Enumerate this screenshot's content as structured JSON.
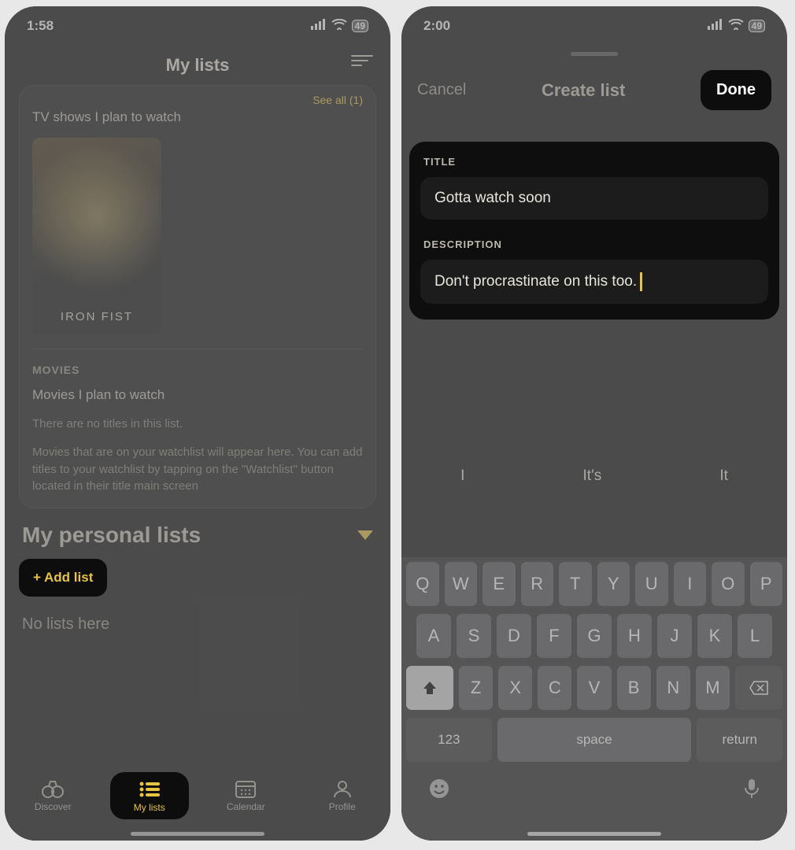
{
  "left": {
    "status": {
      "time": "1:58",
      "battery": "49"
    },
    "nav": {
      "title": "My lists"
    },
    "tvshows": {
      "see_all": "See all (1)",
      "plan_label": "TV shows I plan to watch",
      "poster_title": "IRON FIST"
    },
    "movies": {
      "label": "MOVIES",
      "plan_label": "Movies I plan to watch",
      "empty1": "There are no titles in this list.",
      "empty2": "Movies that are on your watchlist will appear here. You can add titles to your watchlist by tapping on the \"Watchlist\" button located in their title main screen"
    },
    "personal": {
      "header": "My personal lists",
      "add_btn": "+ Add list",
      "empty": "No lists here"
    },
    "tabs": {
      "discover": "Discover",
      "mylists": "My lists",
      "calendar": "Calendar",
      "profile": "Profile"
    }
  },
  "right": {
    "status": {
      "time": "2:00",
      "battery": "49"
    },
    "nav": {
      "cancel": "Cancel",
      "title": "Create list",
      "done": "Done"
    },
    "form": {
      "title_label": "TITLE",
      "title_value": "Gotta watch soon",
      "desc_label": "DESCRIPTION",
      "desc_value": "Don't procrastinate on this too."
    },
    "suggestions": [
      "I",
      "It's",
      "It"
    ],
    "keyboard": {
      "row1": [
        "Q",
        "W",
        "E",
        "R",
        "T",
        "Y",
        "U",
        "I",
        "O",
        "P"
      ],
      "row2": [
        "A",
        "S",
        "D",
        "F",
        "G",
        "H",
        "J",
        "K",
        "L"
      ],
      "row3": [
        "Z",
        "X",
        "C",
        "V",
        "B",
        "N",
        "M"
      ],
      "num": "123",
      "space": "space",
      "ret": "return"
    }
  }
}
